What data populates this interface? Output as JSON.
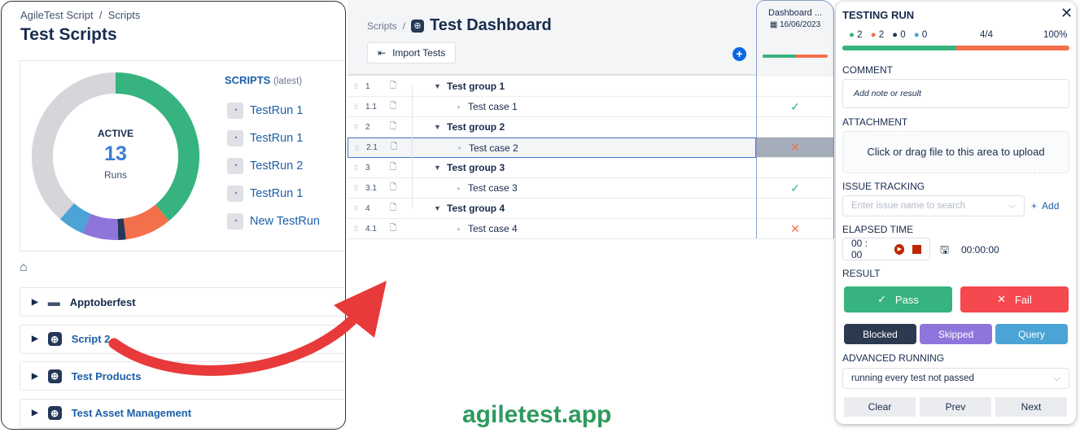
{
  "left": {
    "breadcrumb": [
      "AgileTest Script",
      "/",
      "Scripts"
    ],
    "title": "Test Scripts",
    "donut": {
      "center_label": "ACTIVE",
      "center_value": "13",
      "center_unit": "Runs",
      "segments": [
        {
          "status": "passed",
          "share": 39,
          "color": "#36b37e"
        },
        {
          "status": "failed",
          "share": 9,
          "color": "#f4704a"
        },
        {
          "status": "blocked",
          "share": 1.5,
          "color": "#253858"
        },
        {
          "status": "skipped",
          "share": 7,
          "color": "#8e75dc"
        },
        {
          "status": "query",
          "share": 5,
          "color": "#4ba3d6"
        },
        {
          "status": "untested",
          "share": 38.5,
          "color": "#d4d6d9"
        }
      ]
    },
    "scripts_heading": "SCRIPTS",
    "scripts_sub": "(latest)",
    "runs": [
      "TestRun 1",
      "TestRun 1",
      "TestRun 2",
      "TestRun 1",
      "New TestRun"
    ],
    "folders": [
      {
        "label": "Apptoberfest",
        "icon": "folder-icon"
      },
      {
        "label": "Script 2",
        "icon": "script-icon"
      },
      {
        "label": "Test Products",
        "icon": "script-icon"
      },
      {
        "label": "Test Asset Management",
        "icon": "script-icon"
      }
    ]
  },
  "main": {
    "breadcrumb": "Scripts",
    "sep": "/",
    "title": "Test Dashboard",
    "import_label": "Import Tests",
    "rows": [
      {
        "num": "1",
        "label": "Test group 1",
        "group": true,
        "result": ""
      },
      {
        "num": "1.1",
        "label": "Test case 1",
        "group": false,
        "result": "pass"
      },
      {
        "num": "2",
        "label": "Test group 2",
        "group": true,
        "result": ""
      },
      {
        "num": "2.1",
        "label": "Test case 2",
        "group": false,
        "result": "fail",
        "selected": true
      },
      {
        "num": "3",
        "label": "Test group 3",
        "group": true,
        "result": ""
      },
      {
        "num": "3.1",
        "label": "Test case 3",
        "group": false,
        "result": "pass"
      },
      {
        "num": "4",
        "label": "Test group 4",
        "group": true,
        "result": ""
      },
      {
        "num": "4.1",
        "label": "Test case 4",
        "group": false,
        "result": "fail"
      }
    ],
    "run_column": {
      "title": "Dashboard ...",
      "date": "16/06/2023",
      "progress_pass": 50,
      "progress_fail": 50
    }
  },
  "panel": {
    "title": "TESTING RUN",
    "counts": [
      {
        "v": "2",
        "color": "#36b37e"
      },
      {
        "v": "2",
        "color": "#f4704a"
      },
      {
        "v": "0",
        "color": "#253858"
      },
      {
        "v": "0",
        "color": "#4ba3d6"
      }
    ],
    "done": "4/4",
    "percent": "100%",
    "progress_pass": 50,
    "comment_label": "COMMENT",
    "comment_placeholder": "Add note or result",
    "attachment_label": "ATTACHMENT",
    "upload_text": "Click or drag file to this area to upload",
    "issue_label": "ISSUE TRACKING",
    "issue_placeholder": "Enter issue name to search",
    "add_label": "Add",
    "elapsed_label": "ELAPSED TIME",
    "timer": "00 : 00",
    "elapsed_total": "00:00:00",
    "result_label": "RESULT",
    "pass": "Pass",
    "fail": "Fail",
    "blocked": "Blocked",
    "skipped": "Skipped",
    "query": "Query",
    "advanced_label": "ADVANCED RUNNING",
    "advanced_value": "running every test not passed",
    "clear": "Clear",
    "prev": "Prev",
    "next": "Next"
  },
  "watermark": "agiletest.app"
}
